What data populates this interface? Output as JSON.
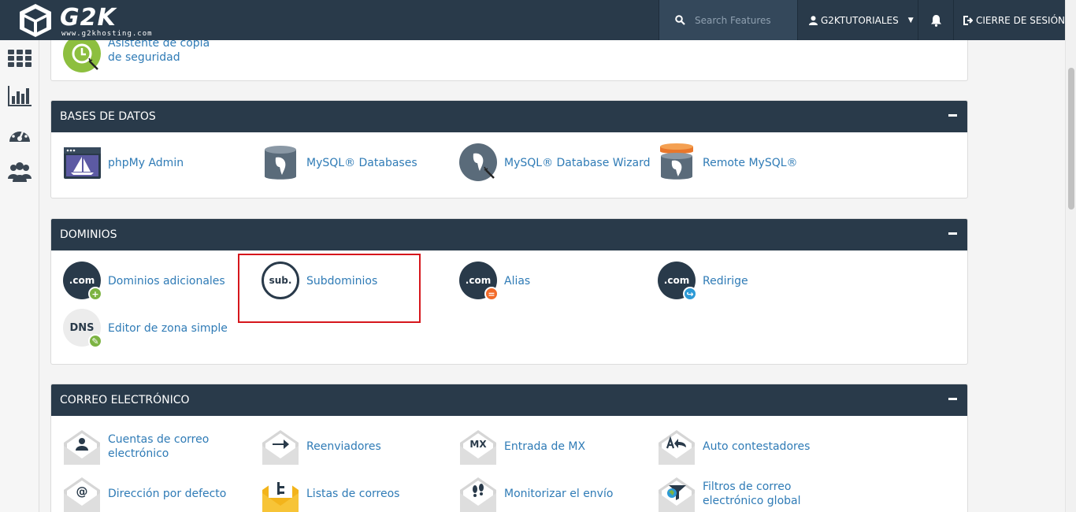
{
  "header": {
    "logo_text": "G2K",
    "logo_sub": "www.g2khosting.com",
    "search_placeholder": "Search Features",
    "user_name": "G2KTUTORIALES",
    "logout_label": "CIERRE DE SESIÓN"
  },
  "backup_item": {
    "label": "Asistente de copia de seguridad"
  },
  "sections": {
    "databases": {
      "title": "BASES DE DATOS",
      "items": [
        "phpMy Admin",
        "MySQL® Databases",
        "MySQL® Database Wizard",
        "Remote MySQL®"
      ]
    },
    "domains": {
      "title": "DOMINIOS",
      "items": [
        "Dominios adicionales",
        "Subdominios",
        "Alias",
        "Redirige",
        "Editor de zona simple"
      ],
      "icon_text": {
        "com": ".com",
        "sub": "sub.",
        "dns": "DNS"
      }
    },
    "email": {
      "title": "CORREO ELECTRÓNICO",
      "items": [
        "Cuentas de correo electrónico",
        "Reenviadores",
        "Entrada de MX",
        "Auto contestadores",
        "Dirección por defecto",
        "Listas de correos",
        "Monitorizar el envío",
        "Filtros de correo electrónico global"
      ],
      "icon_text": {
        "mx": "MX",
        "at": "@"
      }
    }
  },
  "colors": {
    "navbar": "#293a4a",
    "link": "#2f7bb6",
    "highlight": "#d6161c",
    "badge_green": "#7cb342",
    "badge_orange": "#f26b2a",
    "badge_blue": "#2d9ad6"
  }
}
